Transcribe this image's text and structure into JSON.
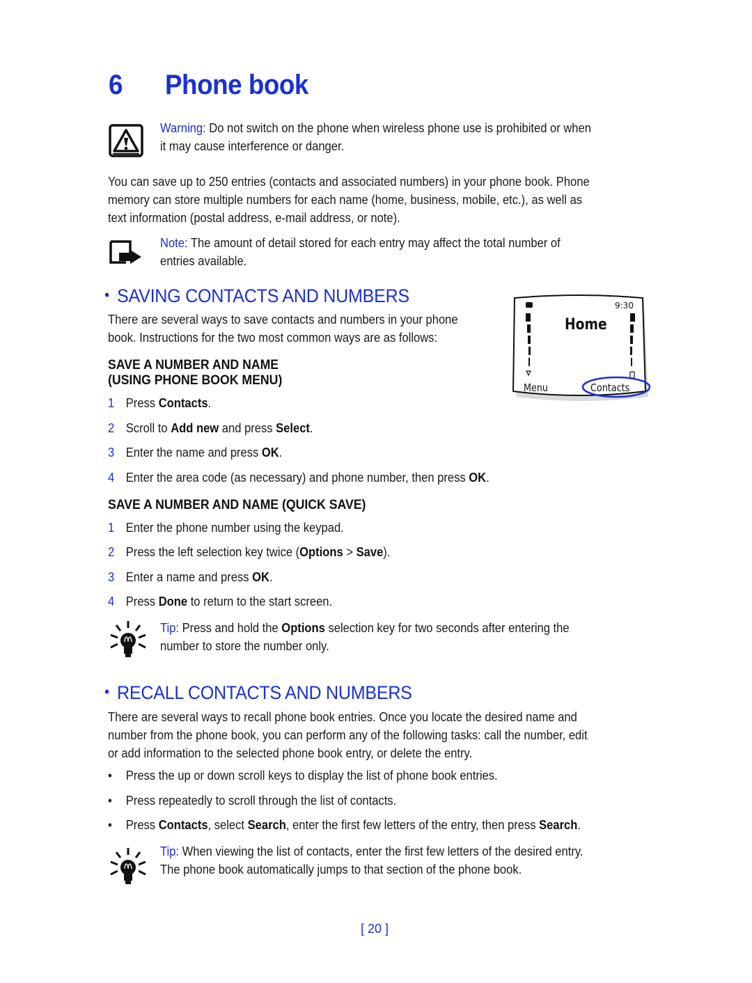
{
  "chapter": {
    "number": "6",
    "title": "Phone book"
  },
  "warning": {
    "label": "Warning:",
    "line1": "Do not switch on the phone when wireless phone use is prohibited or when",
    "line2": "it may cause interference or danger."
  },
  "intro": {
    "line1": "You can save up to 250 entries (contacts and associated numbers) in your phone book. Phone",
    "line2": "memory can store multiple numbers for each name (home, business, mobile, etc.), as well as",
    "line3": "text information (postal address, e-mail address, or note)."
  },
  "note": {
    "label": "Note:",
    "line1": "The amount of detail stored for each entry may affect the total number of",
    "line2": "entries available."
  },
  "saving": {
    "heading": "SAVING CONTACTS AND NUMBERS",
    "line1": "There are several ways to save contacts and numbers in your phone",
    "line2": "book. Instructions for the two most common ways are as follows:",
    "menu_heading_1": "SAVE A NUMBER AND NAME",
    "menu_heading_2": "(USING PHONE BOOK MENU)",
    "menu_steps": [
      {
        "n": "1",
        "pre": "Press ",
        "b1": "Contacts",
        "mid": ".",
        "b2": "",
        "post": ""
      },
      {
        "n": "2",
        "pre": "Scroll to ",
        "b1": "Add new",
        "mid": " and press ",
        "b2": "Select",
        "post": "."
      },
      {
        "n": "3",
        "pre": "Enter the name and press ",
        "b1": "OK",
        "mid": ".",
        "b2": "",
        "post": ""
      },
      {
        "n": "4",
        "pre": "Enter the area code (as necessary) and phone number, then press ",
        "b1": "OK",
        "mid": ".",
        "b2": "",
        "post": ""
      }
    ],
    "quick_heading": "SAVE A NUMBER AND NAME (QUICK SAVE)",
    "quick_steps": [
      {
        "n": "1",
        "pre": "Enter the phone number using the keypad.",
        "b1": "",
        "mid": "",
        "b2": "",
        "post": ""
      },
      {
        "n": "2",
        "pre": "Press the left selection key twice (",
        "b1": "Options",
        "mid": " > ",
        "b2": "Save",
        "post": ")."
      },
      {
        "n": "3",
        "pre": "Enter a name and press ",
        "b1": "OK",
        "mid": ".",
        "b2": "",
        "post": ""
      },
      {
        "n": "4",
        "pre": "Press ",
        "b1": "Done",
        "mid": " to return to the start screen.",
        "b2": "",
        "post": ""
      }
    ],
    "tip": {
      "label": "Tip:",
      "pre": "Press and hold the ",
      "bold": "Options",
      "post": " selection key for two seconds after entering the",
      "line2": "number to store the number only."
    }
  },
  "phone_screen": {
    "time": "9:30",
    "title": "Home",
    "left_softkey": "Menu",
    "right_softkey": "Contacts"
  },
  "recall": {
    "heading": "RECALL CONTACTS AND NUMBERS",
    "line1": "There are several ways to recall phone book entries. Once you locate the desired name and",
    "line2": "number from the phone book, you can perform any of the following tasks: call the number, edit",
    "line3": "or add information to the selected phone book entry, or delete the entry.",
    "bullets": [
      {
        "pre": "Press the up or down scroll keys to display the list of phone book entries.",
        "b1": "",
        "mid": "",
        "b2": "",
        "mid2": "",
        "b3": "",
        "post": ""
      },
      {
        "pre": "Press repeatedly to scroll through the list of contacts.",
        "b1": "",
        "mid": "",
        "b2": "",
        "mid2": "",
        "b3": "",
        "post": ""
      },
      {
        "pre": "Press ",
        "b1": "Contacts",
        "mid": ", select ",
        "b2": "Search",
        "mid2": ", enter the first few letters of the entry, then press ",
        "b3": "Search",
        "post": "."
      }
    ],
    "tip": {
      "label": "Tip:",
      "line1": "When viewing the list of contacts, enter the first few letters of the desired entry.",
      "line2": "The phone book automatically jumps to that section of the phone book."
    }
  },
  "footer": {
    "page_number": "[ 20 ]"
  },
  "colors": {
    "accent": "#1a2fd6",
    "text": "#1a1a1a"
  }
}
